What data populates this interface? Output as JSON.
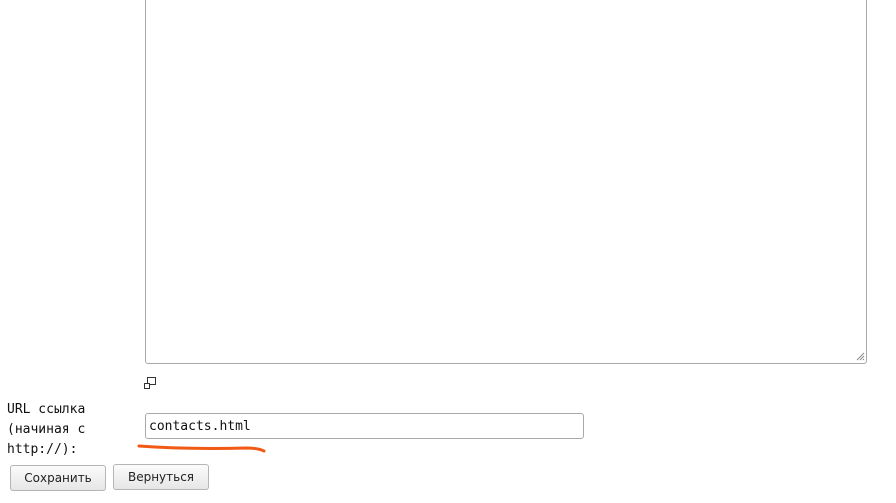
{
  "editor": {
    "content": ""
  },
  "url_field": {
    "label": "URL ссылка (начиная с http://):",
    "value": "contacts.html"
  },
  "buttons": {
    "save_label": "Сохранить",
    "back_label": "Вернуться"
  },
  "icons": {
    "editor_toggle": "window-toggle-icon",
    "resize_grip": "resize-grip-icon"
  },
  "colors": {
    "annotation": "#f05a14",
    "border": "#a9a9a9"
  }
}
